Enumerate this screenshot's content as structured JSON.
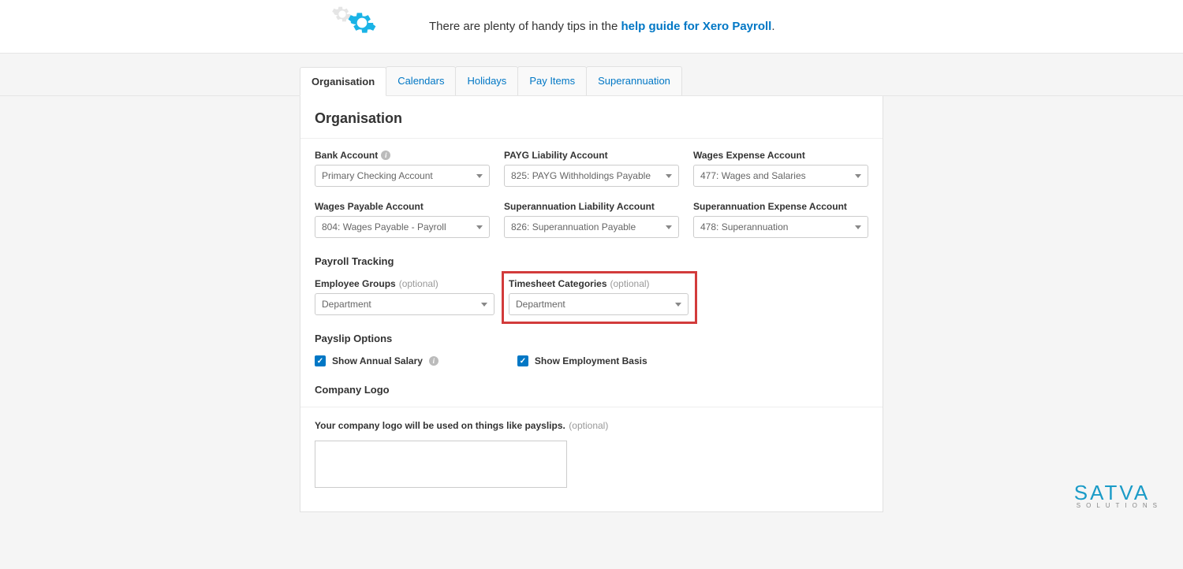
{
  "banner": {
    "text_prefix": "There are plenty of handy tips in the ",
    "link_text": "help guide for Xero Payroll",
    "text_suffix": "."
  },
  "tabs": {
    "items": [
      "Organisation",
      "Calendars",
      "Holidays",
      "Pay Items",
      "Superannuation"
    ],
    "active_index": 0
  },
  "page": {
    "title": "Organisation"
  },
  "accounts_row1": {
    "bank_account": {
      "label": "Bank Account",
      "value": "Primary Checking Account"
    },
    "payg_liability": {
      "label": "PAYG Liability Account",
      "value": "825: PAYG Withholdings Payable"
    },
    "wages_expense": {
      "label": "Wages Expense Account",
      "value": "477: Wages and Salaries"
    }
  },
  "accounts_row2": {
    "wages_payable": {
      "label": "Wages Payable Account",
      "value": "804: Wages Payable - Payroll"
    },
    "super_liability": {
      "label": "Superannuation Liability Account",
      "value": "826: Superannuation Payable"
    },
    "super_expense": {
      "label": "Superannuation Expense Account",
      "value": "478: Superannuation"
    }
  },
  "payroll_tracking": {
    "title": "Payroll Tracking",
    "employee_groups": {
      "label": "Employee Groups",
      "optional": "(optional)",
      "value": "Department"
    },
    "timesheet_categories": {
      "label": "Timesheet Categories",
      "optional": "(optional)",
      "value": "Department"
    }
  },
  "payslip_options": {
    "title": "Payslip Options",
    "show_annual_salary": {
      "label": "Show Annual Salary",
      "checked": true
    },
    "show_employment_basis": {
      "label": "Show Employment Basis",
      "checked": true
    }
  },
  "company_logo": {
    "title": "Company Logo",
    "desc_prefix": "Your company logo will be used on things like payslips.",
    "desc_optional": "(optional)"
  },
  "brand": {
    "name": "SATVA",
    "tagline": "SOLUTIONS"
  }
}
